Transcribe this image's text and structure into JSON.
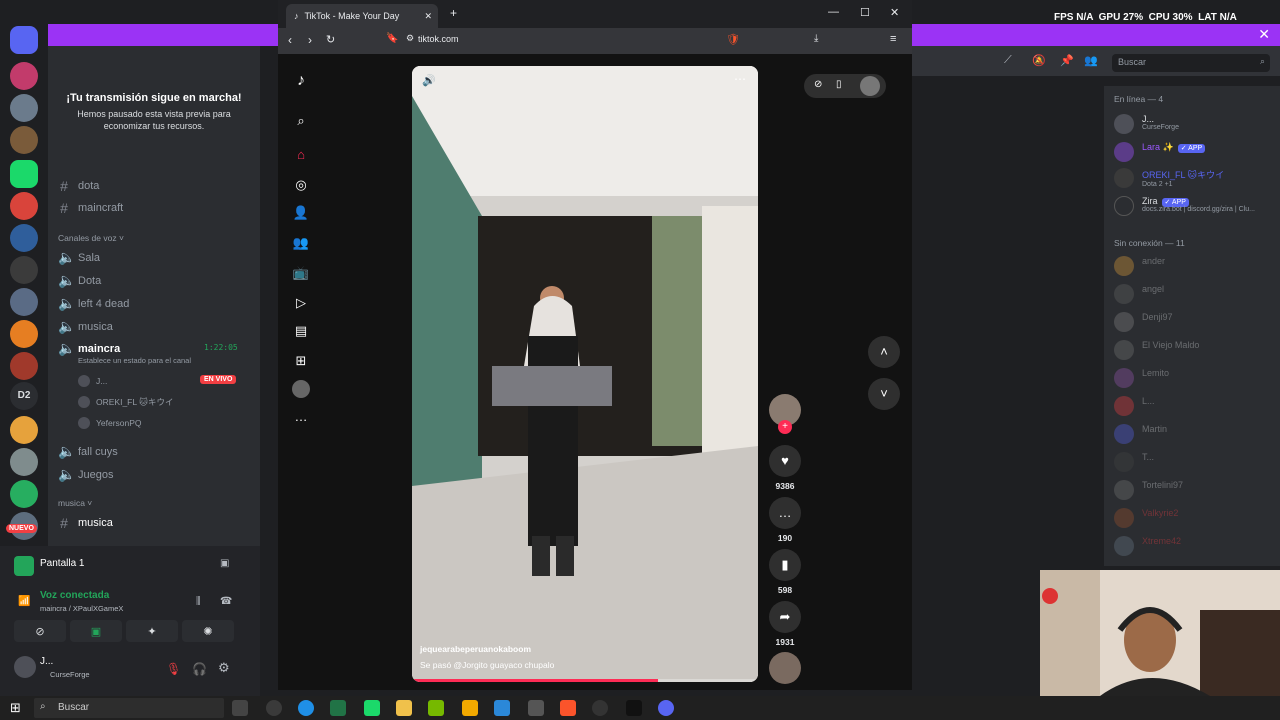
{
  "banner": {
    "close": "✕"
  },
  "channels": {
    "notice_title": "¡Tu transmisión sigue en marcha!",
    "notice_sub": "Hemos pausado esta vista previa para economizar tus recursos.",
    "text": [
      "dota",
      "maincraft"
    ],
    "voice_category": "Canales de voz",
    "voice": [
      "Sala",
      "Dota",
      "left 4 dead",
      "musica"
    ],
    "maincra": "maincra",
    "maincra_time": "1:22:05",
    "maincra_status": "Establece un estado para el canal",
    "voice_users": [
      {
        "name": "J...",
        "badge": "EN VIVO"
      },
      {
        "name": "OREKI_FL 🐱キウイ"
      },
      {
        "name": "YefersonPQ"
      }
    ],
    "voice_after": [
      "fall cuys",
      "Juegos"
    ],
    "music_category": "musica",
    "music_channel": "musica",
    "new_badge": "NUEVO"
  },
  "user_panel": {
    "screen_title": "Pantalla 1",
    "voice_status": "Voz conectada",
    "voice_sub": "maincra / XPaulXGameX",
    "user_name": "J...",
    "user_sub": "CurseForge"
  },
  "browser": {
    "tab_title": "TikTok - Make Your Day",
    "url": "tiktok.com"
  },
  "tiktok": {
    "counts": {
      "likes": "9386",
      "comments": "190",
      "saves": "598",
      "shares": "1931"
    },
    "author": "jequearabeperuanokaboom",
    "caption": "Se pasó @Jorgito guayaco chupalo",
    "progress": 0.71
  },
  "discord": {
    "search_placeholder": "Buscar",
    "online_header": "En línea — 4",
    "online": [
      {
        "name": "J...",
        "sub": "CurseForge",
        "color": "#dbdee1"
      },
      {
        "name": "Lara ✨",
        "tag": "✓ APP",
        "color": "#9b59ff"
      },
      {
        "name": "OREKI_FL 🐱キウイ",
        "sub": "Dota 2 +1",
        "color": "#5865f2"
      },
      {
        "name": "Zira",
        "tag": "✓ APP",
        "sub": "docs.zira.bot | discord.gg/zira | Clu...",
        "color": "#dbdee1"
      }
    ],
    "offline_header": "Sin conexión — 11",
    "offline": [
      "ander",
      "angel",
      "Denji97",
      "El Viejo Maldo",
      "Lemito",
      "L...",
      "Martin",
      "T...",
      "Tortelini97",
      "Valkyrie2",
      "Xtreme42"
    ]
  },
  "taskbar": {
    "search": "Buscar",
    "perf": "FPS N/A  GPU 27%  CPU 30%  LAT N/A"
  }
}
